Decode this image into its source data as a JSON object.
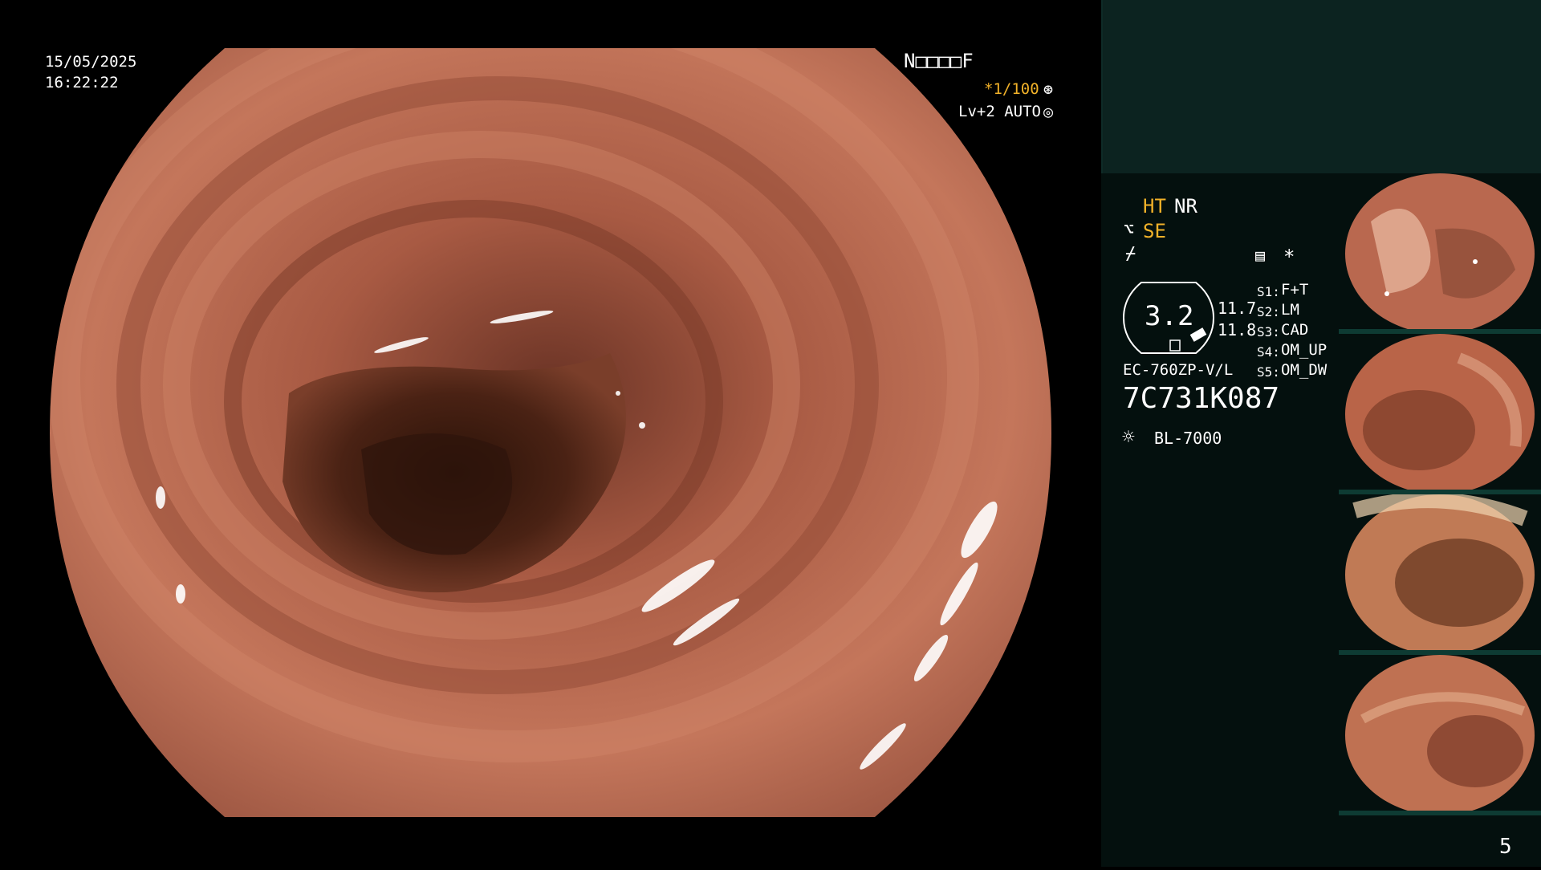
{
  "overlay": {
    "date": "15/05/2025",
    "time": "16:22:22",
    "patient_id": "N□□□□F",
    "shutter": "*1/100",
    "level": "Lv+2 AUTO"
  },
  "panel": {
    "ht": "HT",
    "nr": "NR",
    "se": "SE",
    "star": "*",
    "dial_value": "3.2",
    "val_a": "11.7",
    "val_b": "11.8",
    "scope_model": "EC-760ZP-V/L",
    "serial": "7C731K087",
    "light_source": "BL-7000",
    "switches": [
      {
        "key": "S1:",
        "value": "F+T"
      },
      {
        "key": "S2:",
        "value": "LM"
      },
      {
        "key": "S3:",
        "value": "CAD"
      },
      {
        "key": "S4:",
        "value": "OM_UP"
      },
      {
        "key": "S5:",
        "value": "OM_DW"
      }
    ],
    "page_number": "5"
  },
  "colors": {
    "accent_yellow": "#f2b229",
    "panel_bg": "#04100e",
    "panel_top": "#0c2320",
    "mucosa": "#b9684f"
  }
}
